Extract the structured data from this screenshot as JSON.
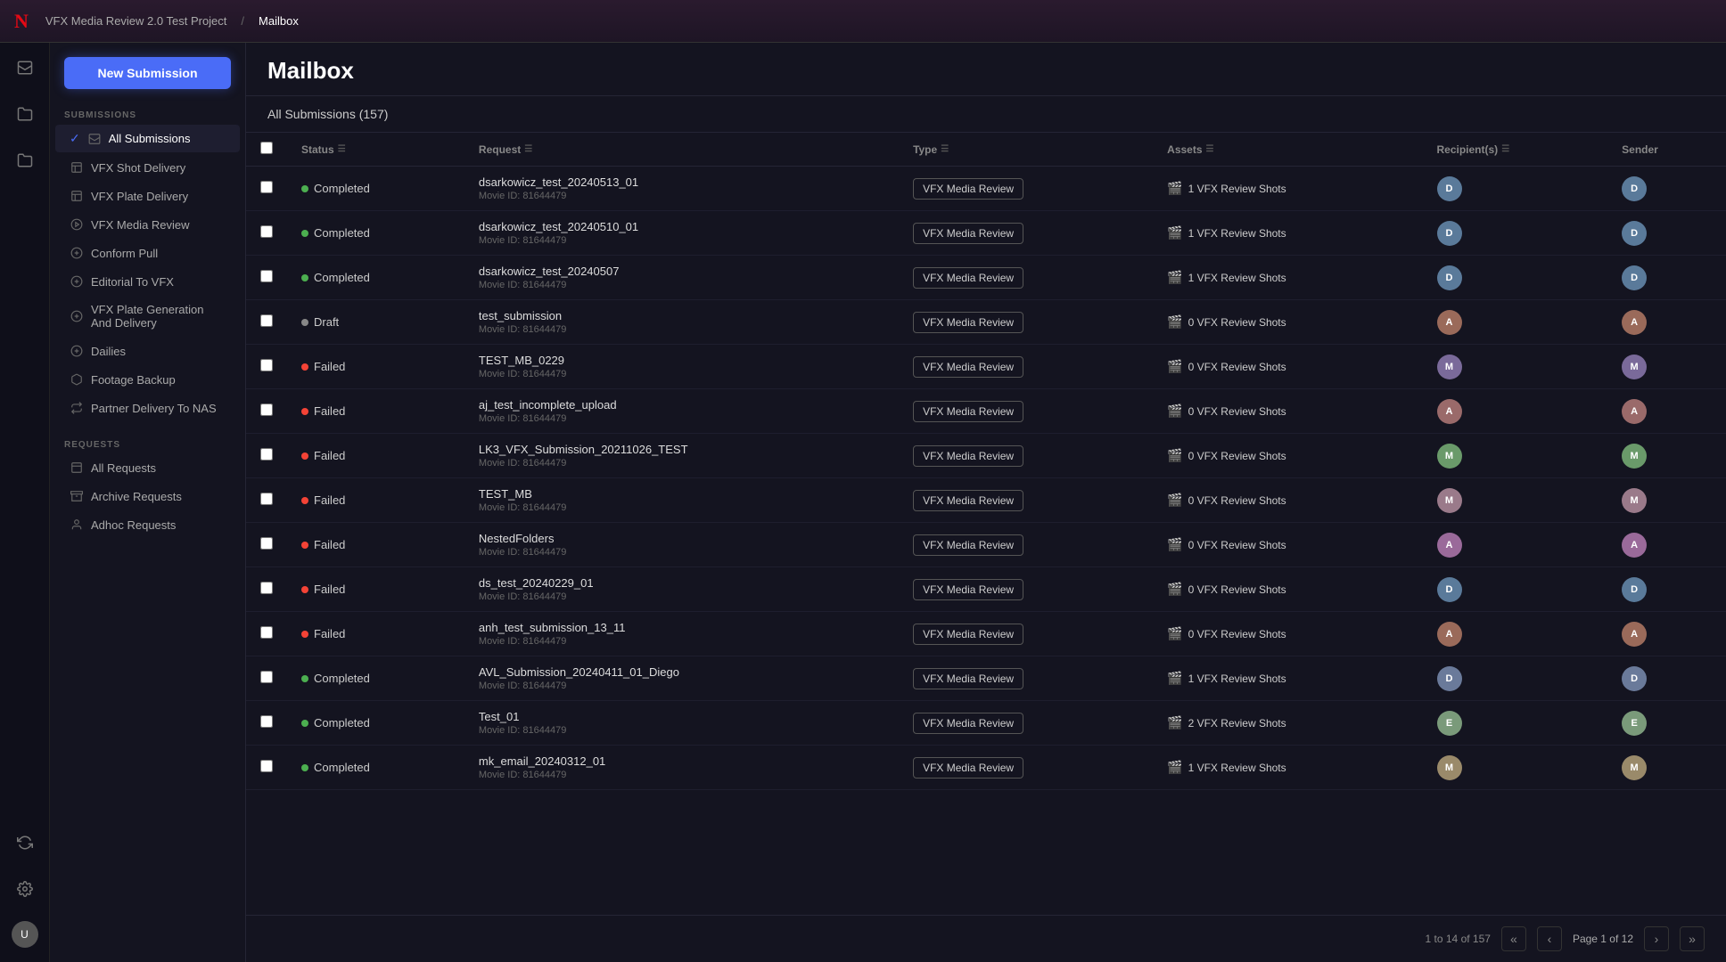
{
  "app": {
    "logo": "N",
    "breadcrumb_project": "VFX Media Review 2.0 Test Project",
    "breadcrumb_separator": "/",
    "breadcrumb_current": "Mailbox",
    "page_title": "Mailbox"
  },
  "toolbar": {
    "new_submission_label": "New Submission"
  },
  "sidebar": {
    "submissions_section": "SUBMISSIONS",
    "requests_section": "REQUESTS",
    "items": [
      {
        "id": "all-submissions",
        "label": "All Submissions",
        "active": true,
        "has_check": true
      },
      {
        "id": "vfx-shot-delivery",
        "label": "VFX Shot Delivery",
        "active": false
      },
      {
        "id": "vfx-plate-delivery",
        "label": "VFX Plate Delivery",
        "active": false
      },
      {
        "id": "vfx-media-review",
        "label": "VFX Media Review",
        "active": false
      },
      {
        "id": "conform-pull",
        "label": "Conform Pull",
        "active": false
      },
      {
        "id": "editorial-to-vfx",
        "label": "Editorial To VFX",
        "active": false
      },
      {
        "id": "vfx-plate-gen",
        "label": "VFX Plate Generation And Delivery",
        "active": false
      },
      {
        "id": "dailies",
        "label": "Dailies",
        "active": false
      },
      {
        "id": "footage-backup",
        "label": "Footage Backup",
        "active": false
      },
      {
        "id": "partner-delivery",
        "label": "Partner Delivery To NAS",
        "active": false
      }
    ],
    "request_items": [
      {
        "id": "all-requests",
        "label": "All Requests"
      },
      {
        "id": "archive-requests",
        "label": "Archive Requests"
      },
      {
        "id": "adhoc-requests",
        "label": "Adhoc Requests"
      }
    ]
  },
  "table": {
    "all_submissions_label": "All Submissions (157)",
    "columns": [
      "Status",
      "Request",
      "Type",
      "Assets",
      "Recipient(s)",
      "Sender"
    ],
    "rows": [
      {
        "status": "Completed",
        "status_type": "completed",
        "request_name": "dsarkowicz_test_20240513_01",
        "movie_id": "Movie ID: 81644479",
        "type": "VFX Media Review",
        "assets_count": "1 VFX Review Shots",
        "avatar_color": "#5a7a9a",
        "avatar_initials": "D"
      },
      {
        "status": "Completed",
        "status_type": "completed",
        "request_name": "dsarkowicz_test_20240510_01",
        "movie_id": "Movie ID: 81644479",
        "type": "VFX Media Review",
        "assets_count": "1 VFX Review Shots",
        "avatar_color": "#5a7a9a",
        "avatar_initials": "D"
      },
      {
        "status": "Completed",
        "status_type": "completed",
        "request_name": "dsarkowicz_test_20240507",
        "movie_id": "Movie ID: 81644479",
        "type": "VFX Media Review",
        "assets_count": "1 VFX Review Shots",
        "avatar_color": "#5a7a9a",
        "avatar_initials": "D"
      },
      {
        "status": "Draft",
        "status_type": "draft",
        "request_name": "test_submission",
        "movie_id": "Movie ID: 81644479",
        "type": "VFX Media Review",
        "assets_count": "0 VFX Review Shots",
        "avatar_color": "#9a6a5a",
        "avatar_initials": "A"
      },
      {
        "status": "Failed",
        "status_type": "failed",
        "request_name": "TEST_MB_0229",
        "movie_id": "Movie ID: 81644479",
        "type": "VFX Media Review",
        "assets_count": "0 VFX Review Shots",
        "avatar_color": "#7a6a9a",
        "avatar_initials": "M"
      },
      {
        "status": "Failed",
        "status_type": "failed",
        "request_name": "aj_test_incomplete_upload",
        "movie_id": "Movie ID: 81644479",
        "type": "VFX Media Review",
        "assets_count": "0 VFX Review Shots",
        "avatar_color": "#9a6a6a",
        "avatar_initials": "A"
      },
      {
        "status": "Failed",
        "status_type": "failed",
        "request_name": "LK3_VFX_Submission_20211026_TEST",
        "movie_id": "Movie ID: 81644479",
        "type": "VFX Media Review",
        "assets_count": "0 VFX Review Shots",
        "avatar_color": "#6a9a6a",
        "avatar_initials": "M"
      },
      {
        "status": "Failed",
        "status_type": "failed",
        "request_name": "TEST_MB",
        "movie_id": "Movie ID: 81644479",
        "type": "VFX Media Review",
        "assets_count": "0 VFX Review Shots",
        "avatar_color": "#9a7a8a",
        "avatar_initials": "M"
      },
      {
        "status": "Failed",
        "status_type": "failed",
        "request_name": "NestedFolders",
        "movie_id": "Movie ID: 81644479",
        "type": "VFX Media Review",
        "assets_count": "0 VFX Review Shots",
        "avatar_color": "#9a6a9a",
        "avatar_initials": "A"
      },
      {
        "status": "Failed",
        "status_type": "failed",
        "request_name": "ds_test_20240229_01",
        "movie_id": "Movie ID: 81644479",
        "type": "VFX Media Review",
        "assets_count": "0 VFX Review Shots",
        "avatar_color": "#5a7a9a",
        "avatar_initials": "D"
      },
      {
        "status": "Failed",
        "status_type": "failed",
        "request_name": "anh_test_submission_13_11",
        "movie_id": "Movie ID: 81644479",
        "type": "VFX Media Review",
        "assets_count": "0 VFX Review Shots",
        "avatar_color": "#9a6a5a",
        "avatar_initials": "A"
      },
      {
        "status": "Completed",
        "status_type": "completed",
        "request_name": "AVL_Submission_20240411_01_Diego",
        "movie_id": "Movie ID: 81644479",
        "type": "VFX Media Review",
        "assets_count": "1 VFX Review Shots",
        "avatar_color": "#6a7a9a",
        "avatar_initials": "D"
      },
      {
        "status": "Completed",
        "status_type": "completed",
        "request_name": "Test_01",
        "movie_id": "Movie ID: 81644479",
        "type": "VFX Media Review",
        "assets_count": "2 VFX Review Shots",
        "avatar_color": "#7a9a7a",
        "avatar_initials": "E"
      },
      {
        "status": "Completed",
        "status_type": "completed",
        "request_name": "mk_email_20240312_01",
        "movie_id": "Movie ID: 81644479",
        "type": "VFX Media Review",
        "assets_count": "1 VFX Review Shots",
        "avatar_color": "#9a8a6a",
        "avatar_initials": "M"
      }
    ]
  },
  "pagination": {
    "info": "1 to 14 of 157",
    "page_label": "Page 1 of 12"
  }
}
